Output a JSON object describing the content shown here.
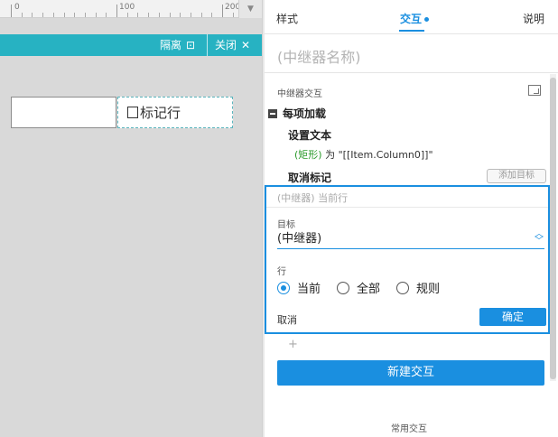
{
  "ruler": {
    "labels": [
      "0",
      "100",
      "200"
    ]
  },
  "toolbar": {
    "isolate_label": "隔离",
    "close_label": "关闭"
  },
  "canvas": {
    "checkbox_label": "标记行"
  },
  "panel": {
    "tabs": [
      {
        "label": "样式"
      },
      {
        "label": "交互"
      },
      {
        "label": "说明"
      }
    ],
    "widget_name": "(中继器名称)",
    "section_title": "中继器交互",
    "event_label": "每项加载",
    "actions": [
      {
        "label": "设置文本",
        "target": "(矩形)",
        "detail": " 为 \"[[Item.Column0]]\""
      },
      {
        "label": "取消标记"
      }
    ],
    "add_target_label": "添加目标",
    "popup": {
      "summary": "(中继器) 当前行",
      "target_label": "目标",
      "target_value": "(中继器)",
      "row_label": "行",
      "radio_options": [
        {
          "label": "当前",
          "checked": true
        },
        {
          "label": "全部",
          "checked": false
        },
        {
          "label": "规则",
          "checked": false
        }
      ],
      "cancel_label": "取消",
      "confirm_label": "确定"
    },
    "add_action_symbol": "+",
    "new_interaction_label": "新建交互",
    "common_interactions_label": "常用交互"
  },
  "colors": {
    "accent": "#1a8fe0",
    "teal": "#27b2c2",
    "green": "#2b9a2b"
  }
}
